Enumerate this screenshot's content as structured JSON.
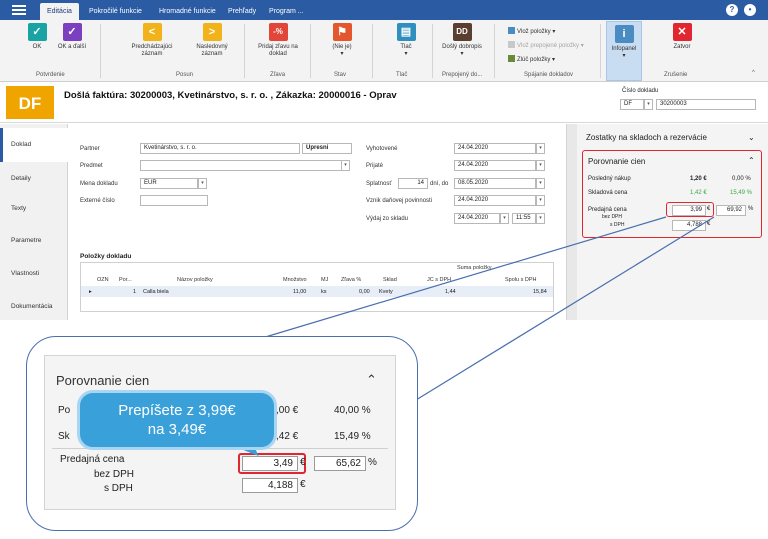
{
  "tabs": [
    "Editácia",
    "Pokročilé funkcie",
    "Hromadné funkcie",
    "Prehľady",
    "Program ..."
  ],
  "ribbon": {
    "ok": "OK",
    "ok_next": "OK a ďalší",
    "prev": "Predchádzajúci záznam",
    "next": "Nasledovný záznam",
    "discount": "Pridaj zľavu na doklad",
    "status_val": "(Nie je)",
    "print": "Tlač",
    "dobropis": "Došlý dobropis",
    "dd_icon": "DD",
    "insert_items": "Vlož položky",
    "insert_linked": "Vlož prepojené položky",
    "merge_items": "Zlúč položky",
    "infopanel": "Infopanel",
    "close": "Zatvor",
    "groups": {
      "confirm": "Potvrdenie",
      "move": "Posun",
      "discount": "Zľava",
      "status": "Stav",
      "print": "Tlač",
      "linked": "Prepojený do...",
      "merge": "Spájanie dokladov",
      "cancel": "Zrušenie"
    }
  },
  "header": {
    "badge": "DF",
    "title": "Došlá faktúra: 30200003, Kvetinárstvo, s. r. o. , Zákazka: 20000016 - Oprav",
    "doc_no_label": "Číslo dokladu",
    "doc_type": "DF",
    "doc_no": "30200003"
  },
  "nav": [
    "Doklad",
    "Detaily",
    "Texty",
    "Parametre",
    "Vlastnosti",
    "Dokumentácia"
  ],
  "form": {
    "partner_label": "Partner",
    "partner": "Kvetinárstvo, s. r. o.",
    "edit_btn": "Upresni",
    "subject_label": "Predmet",
    "currency_label": "Mena dokladu",
    "currency": "EUR",
    "ext_no_label": "Externé číslo",
    "issued_label": "Vyhotovené",
    "issued": "24.04.2020",
    "received_label": "Prijaté",
    "received": "24.04.2020",
    "due_label": "Splatnosť",
    "due_days": "14",
    "days_from": "dní, do",
    "due_date": "08.05.2020",
    "tax_label": "Vznik daňovej povinnosti",
    "tax_date": "24.04.2020",
    "issue_label": "Výdaj zo skladu",
    "issue_date": "24.04.2020",
    "issue_time": "11:55"
  },
  "items": {
    "title": "Položky dokladu",
    "sum_header": "Suma položky",
    "columns": [
      "OZN",
      "Por...",
      "Názov položky",
      "Množstvo",
      "MJ",
      "Zľava %",
      "Sklad",
      "JC s DPH",
      "Spolu s DPH"
    ],
    "row": [
      "1",
      "Calla biela",
      "11,00",
      "ks",
      "0,00",
      "Kvety",
      "1,44",
      "15,84"
    ]
  },
  "panel": {
    "stock_title": "Zostatky na skladoch a rezervácie",
    "compare_title": "Porovnanie cien",
    "last_purchase_label": "Posledný nákup",
    "last_purchase": "1,20 €",
    "last_purchase_pct": "0,00 %",
    "stock_price_label": "Skladová cena",
    "stock_price": "1,42 €",
    "stock_price_pct": "15,49 %",
    "sale_label": "Predajná cena",
    "bez_dph": "bez DPH",
    "s_dph": "s DPH",
    "sale_price": "3,99",
    "sale_pct": "69,92",
    "sale_vat": "4,788",
    "euro": "€",
    "pct": "%"
  },
  "zoom": {
    "title": "Porovnanie cien",
    "row1_a": "Po",
    "row1_price": ",00 €",
    "row1_pct": "40,00 %",
    "row2_a": "Sk",
    "row2_price": ",42 €",
    "row2_pct": "15,49 %",
    "sale_label": "Predajná cena",
    "bez_dph": "bez DPH",
    "s_dph": "s DPH",
    "sale_price": "3,49",
    "sale_pct": "65,62",
    "sale_vat": "4,188",
    "euro": "€",
    "pct": "%"
  },
  "callout": {
    "line1": "Prepíšete z 3,99€",
    "line2": "na 3,49€"
  },
  "colors": {
    "ribbon_blue": "#2a5ba3",
    "badge_orange": "#f0a400",
    "highlight_red": "#e0262f",
    "callout_blue": "#3aa0d9",
    "green_text": "#39a845"
  }
}
